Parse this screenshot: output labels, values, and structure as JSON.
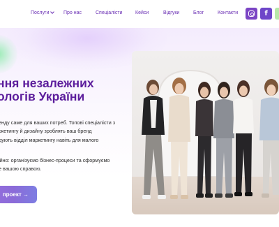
{
  "nav": {
    "items": [
      {
        "label": "Послуги",
        "has_dropdown": true
      },
      {
        "label": "Про нас"
      },
      {
        "label": "Спеціалісти"
      },
      {
        "label": "Кейси"
      },
      {
        "label": "Відгуки"
      },
      {
        "label": "Блог"
      },
      {
        "label": "Контакти"
      }
    ],
    "social": [
      "instagram-icon",
      "facebook-icon"
    ]
  },
  "hero": {
    "title_lines": [
      "ння незалежних",
      "ологів України"
    ],
    "paragraph1": [
      "енду саме для ваших потреб. Топові спеціалісти з",
      "ркетингу й дизайну зроблять ваш бренд",
      "дують відділ маркетингу навіть для малого"
    ],
    "paragraph2": [
      "ійно: організуємо бізнес-процеси та сформуємо",
      "е вашою справою."
    ],
    "cta_label": "проект →"
  },
  "colors": {
    "accent": "#6a2fb4",
    "title": "#5c1d9c",
    "button_from": "#9a6ee0",
    "button_to": "#7d7de2"
  }
}
